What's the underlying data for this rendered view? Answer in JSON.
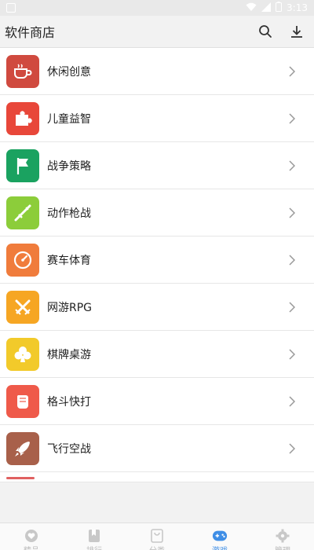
{
  "statusbar": {
    "time": "3:13"
  },
  "header": {
    "title": "软件商店",
    "search_icon": "search-icon",
    "download_icon": "download-icon"
  },
  "categories": [
    {
      "label": "休闲创意",
      "icon": "coffee-cup-icon",
      "color": "#d04a3f"
    },
    {
      "label": "儿童益智",
      "icon": "puzzle-icon",
      "color": "#e8473a"
    },
    {
      "label": "战争策略",
      "icon": "flag-icon",
      "color": "#1aa260"
    },
    {
      "label": "动作枪战",
      "icon": "rifle-icon",
      "color": "#8ccd3a"
    },
    {
      "label": "赛车体育",
      "icon": "speedometer-icon",
      "color": "#f07c3c"
    },
    {
      "label": "网游RPG",
      "icon": "crossed-swords-icon",
      "color": "#f6a623"
    },
    {
      "label": "棋牌桌游",
      "icon": "club-icon",
      "color": "#f2ca2a"
    },
    {
      "label": "格斗快打",
      "icon": "fist-icon",
      "color": "#ef5a4a"
    },
    {
      "label": "飞行空战",
      "icon": "rocket-icon",
      "color": "#a8604a"
    }
  ],
  "tabbar": {
    "tabs": [
      {
        "label": "精品",
        "icon": "heart-icon",
        "active": false
      },
      {
        "label": "排行",
        "icon": "bookmark-icon",
        "active": false
      },
      {
        "label": "分类",
        "icon": "bag-icon",
        "active": false
      },
      {
        "label": "游戏",
        "icon": "gamepad-icon",
        "active": true
      },
      {
        "label": "管理",
        "icon": "gear-icon",
        "active": false
      }
    ],
    "active_color": "#3f8ee6",
    "inactive_color": "#c8c8c8"
  }
}
